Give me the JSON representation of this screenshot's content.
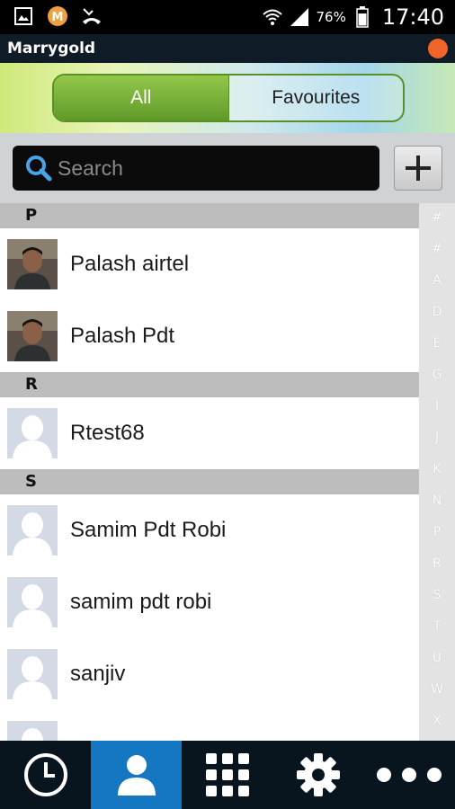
{
  "status_bar": {
    "battery": "76%",
    "time": "17:40",
    "left_icons": [
      "gallery-icon",
      "app-notification-icon",
      "missed-call-icon"
    ],
    "right_icons": [
      "wifi-icon",
      "signal-icon",
      "battery-icon"
    ]
  },
  "app": {
    "title": "Marrygold"
  },
  "tabs": {
    "all": "All",
    "favourites": "Favourites",
    "selected": "All"
  },
  "search": {
    "placeholder": "Search"
  },
  "sections": [
    {
      "letter": "P",
      "contacts": [
        {
          "name": "Palash airtel",
          "avatar": "photo"
        },
        {
          "name": "Palash Pdt",
          "avatar": "photo"
        }
      ]
    },
    {
      "letter": "R",
      "contacts": [
        {
          "name": "Rtest68",
          "avatar": "default"
        }
      ]
    },
    {
      "letter": "S",
      "contacts": [
        {
          "name": "Samim Pdt Robi",
          "avatar": "default"
        },
        {
          "name": "samim pdt robi",
          "avatar": "default"
        },
        {
          "name": "sanjiv",
          "avatar": "default"
        },
        {
          "name": "",
          "avatar": "default"
        }
      ]
    }
  ],
  "alphabet_index": [
    "#",
    "#",
    "A",
    "D",
    "E",
    "G",
    "I",
    "J",
    "K",
    "N",
    "P",
    "R",
    "S",
    "T",
    "U",
    "W",
    "X"
  ],
  "bottom_nav": [
    {
      "icon": "clock-icon",
      "active": false
    },
    {
      "icon": "contacts-icon",
      "active": true
    },
    {
      "icon": "dialpad-icon",
      "active": false
    },
    {
      "icon": "gear-icon",
      "active": false
    },
    {
      "icon": "more-icon",
      "active": false
    }
  ],
  "colors": {
    "accent": "#1576c1",
    "tab_green": "#6fa52f",
    "status_dot": "#f0642a"
  }
}
